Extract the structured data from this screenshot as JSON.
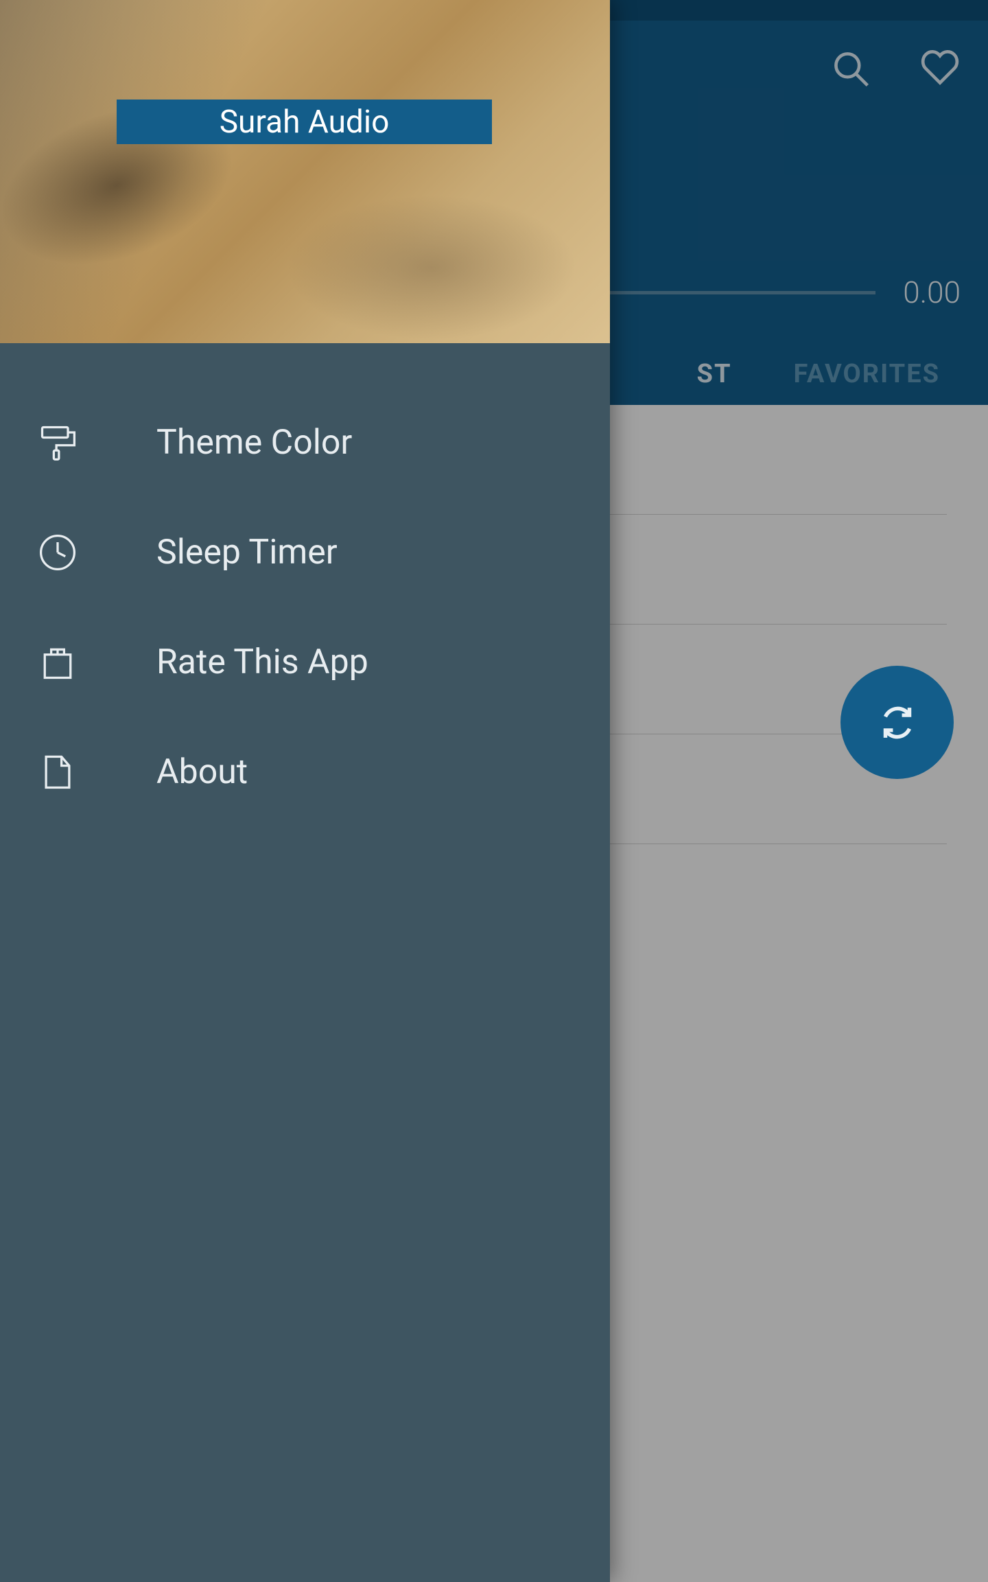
{
  "app": {
    "title": "Surah Audio"
  },
  "player": {
    "time": "0.00"
  },
  "tabs": {
    "playlist_partial": "ST",
    "favorites": "FAVORITES"
  },
  "drawer": {
    "theme_color": "Theme Color",
    "sleep_timer": "Sleep Timer",
    "rate_app": "Rate This App",
    "about": "About"
  },
  "icons": {
    "search": "search",
    "favorite": "heart",
    "repeat": "repeat",
    "fab_sync": "sync",
    "paint_roller": "paint-roller",
    "clock": "clock",
    "bag": "shopping-bag",
    "file": "file"
  }
}
